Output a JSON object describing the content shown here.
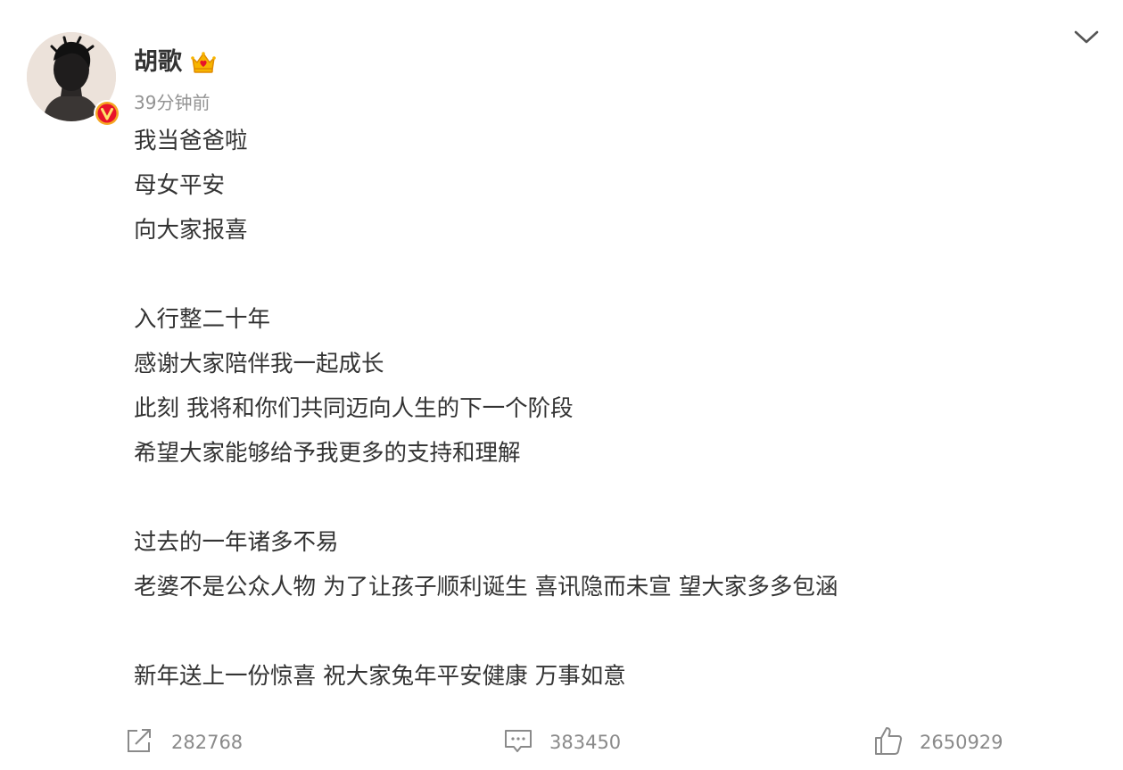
{
  "post": {
    "author": {
      "name": "胡歌",
      "avatar_icon": "avatar-photo",
      "verified_icon": "verified-v-icon",
      "member_icon": "crown-badge-icon"
    },
    "time": "39分钟前",
    "lines": [
      "我当爸爸啦",
      "母女平安",
      "向大家报喜",
      "",
      "入行整二十年",
      "感谢大家陪伴我一起成长",
      "此刻 我将和你们共同迈向人生的下一个阶段",
      "希望大家能够给予我更多的支持和理解",
      "",
      "过去的一年诸多不易",
      "老婆不是公众人物 为了让孩子顺利诞生 喜讯隐而未宣 望大家多多包涵",
      "",
      "新年送上一份惊喜 祝大家兔年平安健康 万事如意"
    ]
  },
  "actions": {
    "share": {
      "icon": "share-icon",
      "count": "282768"
    },
    "comment": {
      "icon": "comment-icon",
      "count": "383450"
    },
    "like": {
      "icon": "thumbs-up-icon",
      "count": "2650929"
    }
  },
  "menu": {
    "icon": "chevron-down-icon"
  },
  "colors": {
    "text": "#333333",
    "muted": "#939393",
    "icon": "#8a8a8a",
    "badge_orange": "#f5a623",
    "badge_red": "#e8132a"
  }
}
